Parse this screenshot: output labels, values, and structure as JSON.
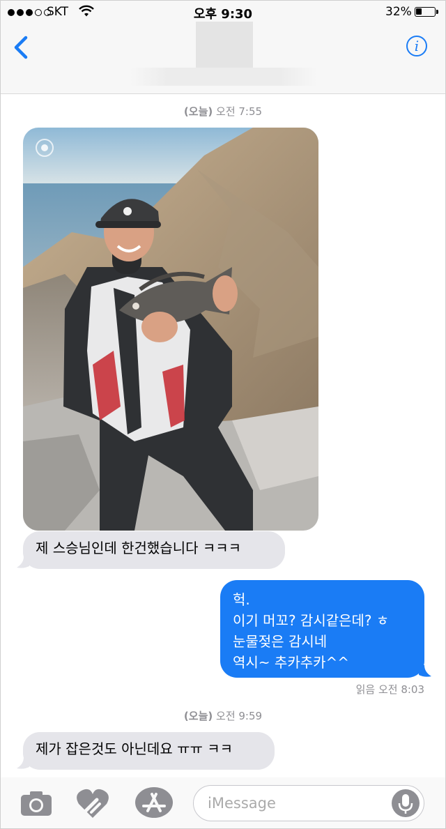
{
  "status_bar": {
    "carrier": "SKT",
    "time": "오후 9:30",
    "battery_percent": "32%",
    "battery_level": 0.32,
    "signal_bars": 3
  },
  "nav": {
    "back_icon": "chevron-left-icon",
    "info_icon": "info-icon",
    "accent_color": "#1a7cf5"
  },
  "messages": {
    "stamp1": {
      "day": "(오늘)",
      "time": "오전 7:55"
    },
    "photo_icon": "live-photo-icon",
    "msg1": "제 스승님인데 한건했습니다 ㅋㅋㅋ",
    "msg2": {
      "lines": [
        "헉.",
        "이기 머꼬? 감시같은데? ㅎ",
        "눈물젖은 감시네",
        "역시~ 추카추카^^"
      ]
    },
    "read_receipt": "읽음 오전 8:03",
    "stamp2": {
      "day": "(오늘)",
      "time": "오전 9:59"
    },
    "msg3": "제가 잡은것도 아닌데요 ㅠㅠ ㅋㅋ",
    "incoming_color": "#e5e5ea",
    "outgoing_color": "#1a7cf5"
  },
  "composer": {
    "placeholder": "iMessage",
    "camera_icon": "camera-icon",
    "digital_touch_icon": "digital-touch-heart-icon",
    "app_store_icon": "app-store-icon",
    "mic_icon": "microphone-icon"
  }
}
